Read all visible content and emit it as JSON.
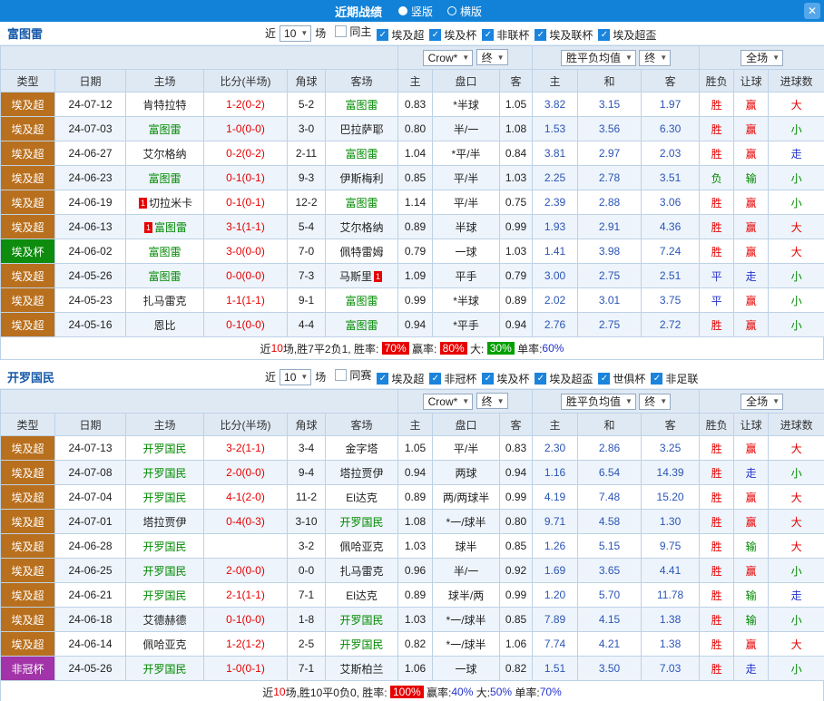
{
  "titlebar": {
    "title": "近期战绩",
    "radio_vertical": "竖版",
    "radio_horizontal": "横版",
    "close_icon": "✕"
  },
  "type_colors": {
    "埃及超": "#b8701e",
    "埃及杯": "#0e8c0e",
    "非冠杯": "#a233a8"
  },
  "value_colors": {
    "胜": "#e60000",
    "平": "#2433cc",
    "负": "#008a00",
    "赢": "#e60000",
    "走": "#2433cc",
    "输": "#008a00",
    "大": "#e60000",
    "小": "#008a00"
  },
  "focal_color": "#008a00",
  "columns": [
    "类型",
    "日期",
    "主场",
    "比分(半场)",
    "角球",
    "客场",
    "主",
    "盘口",
    "客",
    "主",
    "和",
    "客",
    "胜负",
    "让球",
    "进球数"
  ],
  "sections": [
    {
      "team": "富图雷",
      "filter": {
        "near": "近",
        "count": "10",
        "unit": "场",
        "checkboxes": [
          {
            "label": "同主",
            "checked": false
          },
          {
            "label": "埃及超",
            "checked": true
          },
          {
            "label": "埃及杯",
            "checked": true
          },
          {
            "label": "非联杯",
            "checked": true
          },
          {
            "label": "埃及联杯",
            "checked": true
          },
          {
            "label": "埃及超盃",
            "checked": true
          }
        ]
      },
      "selects": {
        "bookmaker": "Crow*",
        "bk_final": "终",
        "europe": "胜平负均值",
        "eu_final": "终",
        "scope": "全场"
      },
      "rows": [
        {
          "type": "埃及超",
          "date": "24-07-12",
          "home": "肯特拉特",
          "score": "1-2(0-2)",
          "corner": "5-2",
          "away": "富图雷",
          "asian_home": "0.83",
          "handicap": "*半球",
          "asian_away": "1.05",
          "euro_home": "3.82",
          "euro_draw": "3.15",
          "euro_away": "1.97",
          "result": "胜",
          "cover": "赢",
          "goals": "大"
        },
        {
          "type": "埃及超",
          "date": "24-07-03",
          "home": "富图雷",
          "score": "1-0(0-0)",
          "corner": "3-0",
          "away": "巴拉萨耶",
          "asian_home": "0.80",
          "handicap": "半/一",
          "asian_away": "1.08",
          "euro_home": "1.53",
          "euro_draw": "3.56",
          "euro_away": "6.30",
          "result": "胜",
          "cover": "赢",
          "goals": "小"
        },
        {
          "type": "埃及超",
          "date": "24-06-27",
          "home": "艾尔格纳",
          "score": "0-2(0-2)",
          "corner": "2-11",
          "away": "富图雷",
          "asian_home": "1.04",
          "handicap": "*平/半",
          "asian_away": "0.84",
          "euro_home": "3.81",
          "euro_draw": "2.97",
          "euro_away": "2.03",
          "result": "胜",
          "cover": "赢",
          "goals": "走"
        },
        {
          "type": "埃及超",
          "date": "24-06-23",
          "home": "富图雷",
          "score": "0-1(0-1)",
          "corner": "9-3",
          "away": "伊斯梅利",
          "asian_home": "0.85",
          "handicap": "平/半",
          "asian_away": "1.03",
          "euro_home": "2.25",
          "euro_draw": "2.78",
          "euro_away": "3.51",
          "result": "负",
          "cover": "输",
          "goals": "小"
        },
        {
          "type": "埃及超",
          "date": "24-06-19",
          "home": "切拉米卡",
          "home_mark_pre": "1",
          "score": "0-1(0-1)",
          "corner": "12-2",
          "away": "富图雷",
          "asian_home": "1.14",
          "handicap": "平/半",
          "asian_away": "0.75",
          "euro_home": "2.39",
          "euro_draw": "2.88",
          "euro_away": "3.06",
          "result": "胜",
          "cover": "赢",
          "goals": "小"
        },
        {
          "type": "埃及超",
          "date": "24-06-13",
          "home": "富图雷",
          "home_mark_pre": "1",
          "score": "3-1(1-1)",
          "corner": "5-4",
          "away": "艾尔格纳",
          "asian_home": "0.89",
          "handicap": "半球",
          "asian_away": "0.99",
          "euro_home": "1.93",
          "euro_draw": "2.91",
          "euro_away": "4.36",
          "result": "胜",
          "cover": "赢",
          "goals": "大"
        },
        {
          "type": "埃及杯",
          "date": "24-06-02",
          "home": "富图雷",
          "score": "3-0(0-0)",
          "corner": "7-0",
          "away": "佩特雷姆",
          "asian_home": "0.79",
          "handicap": "一球",
          "asian_away": "1.03",
          "euro_home": "1.41",
          "euro_draw": "3.98",
          "euro_away": "7.24",
          "result": "胜",
          "cover": "赢",
          "goals": "大"
        },
        {
          "type": "埃及超",
          "date": "24-05-26",
          "home": "富图雷",
          "score": "0-0(0-0)",
          "corner": "7-3",
          "away": "马斯里",
          "away_mark_post": "1",
          "asian_home": "1.09",
          "handicap": "平手",
          "asian_away": "0.79",
          "euro_home": "3.00",
          "euro_draw": "2.75",
          "euro_away": "2.51",
          "result": "平",
          "cover": "走",
          "goals": "小"
        },
        {
          "type": "埃及超",
          "date": "24-05-23",
          "home": "扎马雷克",
          "score": "1-1(1-1)",
          "corner": "9-1",
          "away": "富图雷",
          "asian_home": "0.99",
          "handicap": "*半球",
          "asian_away": "0.89",
          "euro_home": "2.02",
          "euro_draw": "3.01",
          "euro_away": "3.75",
          "result": "平",
          "cover": "赢",
          "goals": "小"
        },
        {
          "type": "埃及超",
          "date": "24-05-16",
          "home": "恩比",
          "score": "0-1(0-0)",
          "corner": "4-4",
          "away": "富图雷",
          "asian_home": "0.94",
          "handicap": "*平手",
          "asian_away": "0.94",
          "euro_home": "2.76",
          "euro_draw": "2.75",
          "euro_away": "2.72",
          "result": "胜",
          "cover": "赢",
          "goals": "小"
        }
      ],
      "summary": {
        "lead_pre": "近",
        "lead_count": "10",
        "lead_post": "场,胜7平2负1, 胜率: ",
        "stats": [
          {
            "label": "",
            "value": "70%",
            "style": "badge-red"
          },
          {
            "label": " 赢率: ",
            "value": "80%",
            "style": "badge-red"
          },
          {
            "label": " 大: ",
            "value": "30%",
            "style": "badge-green"
          },
          {
            "label": " 单率:",
            "value": "60%",
            "style": "text-blue"
          }
        ]
      }
    },
    {
      "team": "开罗国民",
      "filter": {
        "near": "近",
        "count": "10",
        "unit": "场",
        "checkboxes": [
          {
            "label": "同赛",
            "checked": false
          },
          {
            "label": "埃及超",
            "checked": true
          },
          {
            "label": "非冠杯",
            "checked": true
          },
          {
            "label": "埃及杯",
            "checked": true
          },
          {
            "label": "埃及超盃",
            "checked": true
          },
          {
            "label": "世俱杯",
            "checked": true
          },
          {
            "label": "非足联",
            "checked": true
          }
        ]
      },
      "selects": {
        "bookmaker": "Crow*",
        "bk_final": "终",
        "europe": "胜平负均值",
        "eu_final": "终",
        "scope": "全场"
      },
      "rows": [
        {
          "type": "埃及超",
          "date": "24-07-13",
          "home": "开罗国民",
          "score": "3-2(1-1)",
          "corner": "3-4",
          "away": "金字塔",
          "asian_home": "1.05",
          "handicap": "平/半",
          "asian_away": "0.83",
          "euro_home": "2.30",
          "euro_draw": "2.86",
          "euro_away": "3.25",
          "result": "胜",
          "cover": "赢",
          "goals": "大"
        },
        {
          "type": "埃及超",
          "date": "24-07-08",
          "home": "开罗国民",
          "score": "2-0(0-0)",
          "corner": "9-4",
          "away": "塔拉贾伊",
          "asian_home": "0.94",
          "handicap": "两球",
          "asian_away": "0.94",
          "euro_home": "1.16",
          "euro_draw": "6.54",
          "euro_away": "14.39",
          "result": "胜",
          "cover": "走",
          "goals": "小"
        },
        {
          "type": "埃及超",
          "date": "24-07-04",
          "home": "开罗国民",
          "score": "4-1(2-0)",
          "corner": "11-2",
          "away": "El达克",
          "asian_home": "0.89",
          "handicap": "两/两球半",
          "asian_away": "0.99",
          "euro_home": "4.19",
          "euro_draw": "7.48",
          "euro_away": "15.20",
          "result": "胜",
          "cover": "赢",
          "goals": "大"
        },
        {
          "type": "埃及超",
          "date": "24-07-01",
          "home": "塔拉贾伊",
          "score": "0-4(0-3)",
          "corner": "3-10",
          "away": "开罗国民",
          "asian_home": "1.08",
          "handicap": "*一/球半",
          "asian_away": "0.80",
          "euro_home": "9.71",
          "euro_draw": "4.58",
          "euro_away": "1.30",
          "result": "胜",
          "cover": "赢",
          "goals": "大"
        },
        {
          "type": "埃及超",
          "date": "24-06-28",
          "home": "开罗国民",
          "score": "",
          "corner": "3-2",
          "away": "佩哈亚克",
          "asian_home": "1.03",
          "handicap": "球半",
          "asian_away": "0.85",
          "euro_home": "1.26",
          "euro_draw": "5.15",
          "euro_away": "9.75",
          "result": "胜",
          "cover": "输",
          "goals": "大"
        },
        {
          "type": "埃及超",
          "date": "24-06-25",
          "home": "开罗国民",
          "score": "2-0(0-0)",
          "corner": "0-0",
          "away": "扎马雷克",
          "asian_home": "0.96",
          "handicap": "半/一",
          "asian_away": "0.92",
          "euro_home": "1.69",
          "euro_draw": "3.65",
          "euro_away": "4.41",
          "result": "胜",
          "cover": "赢",
          "goals": "小"
        },
        {
          "type": "埃及超",
          "date": "24-06-21",
          "home": "开罗国民",
          "score": "2-1(1-1)",
          "corner": "7-1",
          "away": "El达克",
          "asian_home": "0.89",
          "handicap": "球半/两",
          "asian_away": "0.99",
          "euro_home": "1.20",
          "euro_draw": "5.70",
          "euro_away": "11.78",
          "result": "胜",
          "cover": "输",
          "goals": "走"
        },
        {
          "type": "埃及超",
          "date": "24-06-18",
          "home": "艾德赫德",
          "score": "0-1(0-0)",
          "corner": "1-8",
          "away": "开罗国民",
          "asian_home": "1.03",
          "handicap": "*一/球半",
          "asian_away": "0.85",
          "euro_home": "7.89",
          "euro_draw": "4.15",
          "euro_away": "1.38",
          "result": "胜",
          "cover": "输",
          "goals": "小"
        },
        {
          "type": "埃及超",
          "date": "24-06-14",
          "home": "佩哈亚克",
          "score": "1-2(1-2)",
          "corner": "2-5",
          "away": "开罗国民",
          "asian_home": "0.82",
          "handicap": "*一/球半",
          "asian_away": "1.06",
          "euro_home": "7.74",
          "euro_draw": "4.21",
          "euro_away": "1.38",
          "result": "胜",
          "cover": "赢",
          "goals": "大"
        },
        {
          "type": "非冠杯",
          "date": "24-05-26",
          "home": "开罗国民",
          "score": "1-0(0-1)",
          "corner": "7-1",
          "away": "艾斯柏兰",
          "asian_home": "1.06",
          "handicap": "一球",
          "asian_away": "0.82",
          "euro_home": "1.51",
          "euro_draw": "3.50",
          "euro_away": "7.03",
          "result": "胜",
          "cover": "走",
          "goals": "小"
        }
      ],
      "summary": {
        "lead_pre": "近",
        "lead_count": "10",
        "lead_post": "场,胜10平0负0, 胜率: ",
        "stats": [
          {
            "label": "",
            "value": "100%",
            "style": "badge-red"
          },
          {
            "label": " 赢率:",
            "value": "40%",
            "style": "text-blue"
          },
          {
            "label": " 大:",
            "value": "50%",
            "style": "text-blue"
          },
          {
            "label": " 单率:",
            "value": "70%",
            "style": "text-blue"
          }
        ]
      }
    }
  ]
}
